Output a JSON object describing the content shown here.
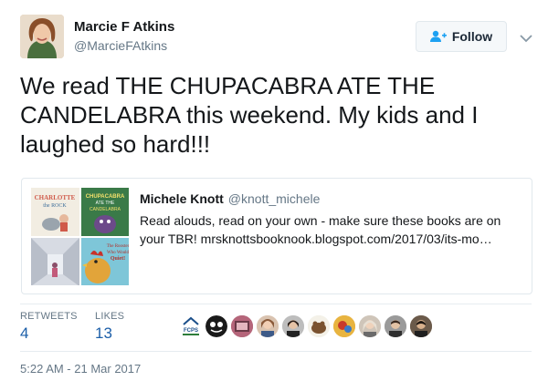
{
  "author": {
    "name": "Marcie F Atkins",
    "handle": "@MarcieFAtkins"
  },
  "follow": {
    "label": "Follow"
  },
  "tweet": {
    "lines": [
      "We read THE CHUPACABRA ATE THE",
      "CANDELABRA this weekend. My kids and I",
      "laughed so hard!!!"
    ]
  },
  "quoted": {
    "name": "Michele Knott",
    "handle": "@knott_michele",
    "lines": [
      "Read alouds, read on your own - make sure these books are on",
      "your TBR! mrsknottsbooknook.blogspot.com/2017/03/its-mo…"
    ],
    "thumbs": [
      {
        "title": "CHARLOTTE the ROCK"
      },
      {
        "title": "CHUPACABRA ATE THE CANDELABRA"
      },
      {
        "title": ""
      },
      {
        "title": "The Rooster Who Would Not Be Quiet!"
      }
    ]
  },
  "stats": {
    "retweets_label": "RETWEETS",
    "retweets_value": "4",
    "likes_label": "LIKES",
    "likes_value": "13"
  },
  "likers_badge": {
    "text": "FCPS"
  },
  "timestamp": "5:22 AM - 21 Mar 2017",
  "colors": {
    "link": "#1b5ea8",
    "muted": "#657786",
    "border": "#e1e8ed"
  }
}
